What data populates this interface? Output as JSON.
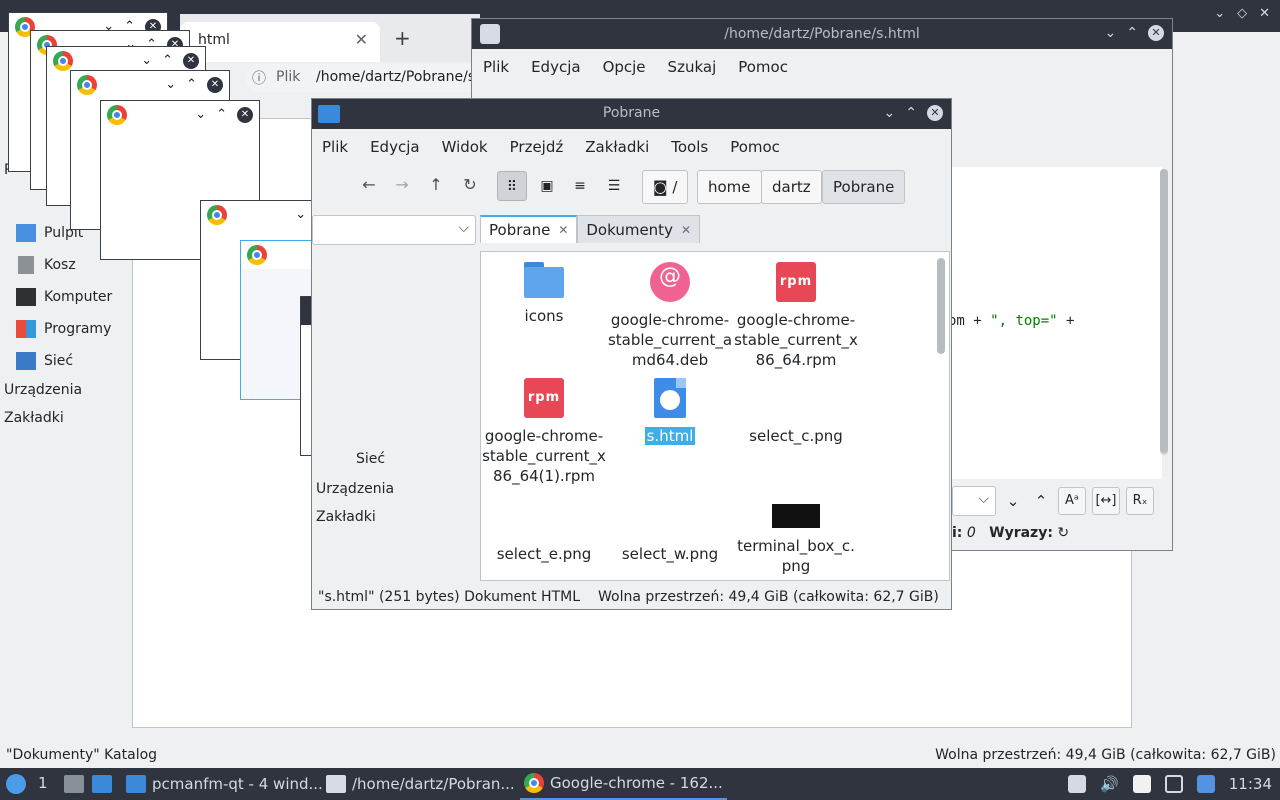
{
  "background_fm": {
    "sidebar_items": [
      {
        "label": "Pulpit",
        "icon": "desktop-folder-icon"
      },
      {
        "label": "Kosz",
        "icon": "trash-icon"
      },
      {
        "label": "Komputer",
        "icon": "computer-icon"
      },
      {
        "label": "Programy",
        "icon": "applications-icon"
      },
      {
        "label": "Sieć",
        "icon": "network-icon"
      }
    ],
    "groups": [
      "Urządzenia",
      "Zakładki"
    ],
    "status_left": "\"Dokumenty\" Katalog",
    "status_right": "Wolna przestrzeń: 49,4 GiB (całkowita: 62,7 GiB)",
    "truncated_label_p": "P"
  },
  "browser": {
    "tab_title": "html",
    "new_tab": "+",
    "omnibox_info": "ⓘ",
    "omnibox_security": "Plik",
    "omnibox_url": "/home/dartz/Pobrane/s"
  },
  "editor": {
    "title": "/home/dartz/Pobrane/s.html",
    "menu": [
      "Plik",
      "Edycja",
      "Opcje",
      "Szukaj",
      "Pomoc"
    ],
    "code_prefix": "om + ",
    "code_str1": "\", top=\"",
    "code_suffix": " +",
    "findbar_buttons": [
      "Aᵃ",
      "[↔]",
      "Rₓ"
    ],
    "stat_italic": "0",
    "stat_label": "Wyrazy:",
    "stat_prefix": "i:"
  },
  "cascade": {
    "partial_menu": "k",
    "partial_group": "Sieć"
  },
  "fm": {
    "title": "Pobrane",
    "menu": [
      "Plik",
      "Edycja",
      "Widok",
      "Przejdź",
      "Zakładki",
      "Tools",
      "Pomoc"
    ],
    "path_root": "/",
    "breadcrumbs": [
      "home",
      "dartz",
      "Pobrane"
    ],
    "tabs": [
      {
        "label": "Pobrane",
        "active": true
      },
      {
        "label": "Dokumenty",
        "active": false
      }
    ],
    "side_groups": [
      "Urządzenia",
      "Zakładki"
    ],
    "side_partial": "Sieć",
    "files": [
      {
        "name": "icons",
        "type": "folder"
      },
      {
        "name": "google-chrome-stable_current_amd64.deb",
        "type": "deb"
      },
      {
        "name": "google-chrome-stable_current_x86_64.rpm",
        "type": "rpm"
      },
      {
        "name": "google-chrome-stable_current_x86_64(1).rpm",
        "type": "rpm"
      },
      {
        "name": "s.html",
        "type": "html",
        "selected": true
      },
      {
        "name": "select_c.png",
        "type": "png"
      },
      {
        "name": "select_e.png",
        "type": "png"
      },
      {
        "name": "select_w.png",
        "type": "png"
      },
      {
        "name": "terminal_box_c.png",
        "type": "png-dark"
      }
    ],
    "file_lines": {
      "f1": [
        "google-chrome-",
        "stable_current_a",
        "md64.deb"
      ],
      "f2": [
        "google-chrome-",
        "stable_current_x",
        "86_64.rpm"
      ],
      "f3": [
        "google-chrome-",
        "stable_current_x",
        "86_64(1).rpm"
      ],
      "f8": [
        "terminal_box_c.",
        "png"
      ]
    },
    "status_left": "\"s.html\" (251 bytes) Dokument HTML",
    "status_right": "Wolna przestrzeń: 49,4 GiB (całkowita: 62,7 GiB)"
  },
  "taskbar": {
    "desktop_number": "1",
    "tasks": [
      {
        "label": "pcmanfm-qt - 4 wind...",
        "icon": "folder-icon"
      },
      {
        "label": "/home/dartz/Pobran...",
        "icon": "text-editor-icon"
      },
      {
        "label": "Google-chrome - 162...",
        "icon": "chrome-icon",
        "active": true
      }
    ],
    "clock": "11:34"
  },
  "colors": {
    "titlebar": "#2f343f",
    "accent": "#3daee9",
    "selection": "#3daee9",
    "rpm": "#e84855",
    "deb": "#f06292",
    "folder": "#5ea5ee"
  }
}
